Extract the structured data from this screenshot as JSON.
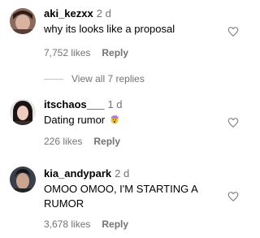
{
  "comments": [
    {
      "username": "aki_kezxx",
      "time": "2 d",
      "text": "why its looks like a proposal",
      "likes": "7,752 likes",
      "reply": "Reply"
    },
    {
      "username": "itschaos___",
      "time": "1 d",
      "text": "Dating rumor",
      "emoji": "exploding-head",
      "likes": "226 likes",
      "reply": "Reply"
    },
    {
      "username": "kia_andypark",
      "time": "2 d",
      "text": "OMOO OMOO, I'M STARTING A RUMOR",
      "likes": "3,678 likes",
      "reply": "Reply"
    }
  ],
  "view_replies": "View all 7 replies",
  "icons": {
    "like": "heart-outline-icon"
  },
  "colors": {
    "secondary_text": "#737373",
    "divider": "#c7c7c7"
  }
}
